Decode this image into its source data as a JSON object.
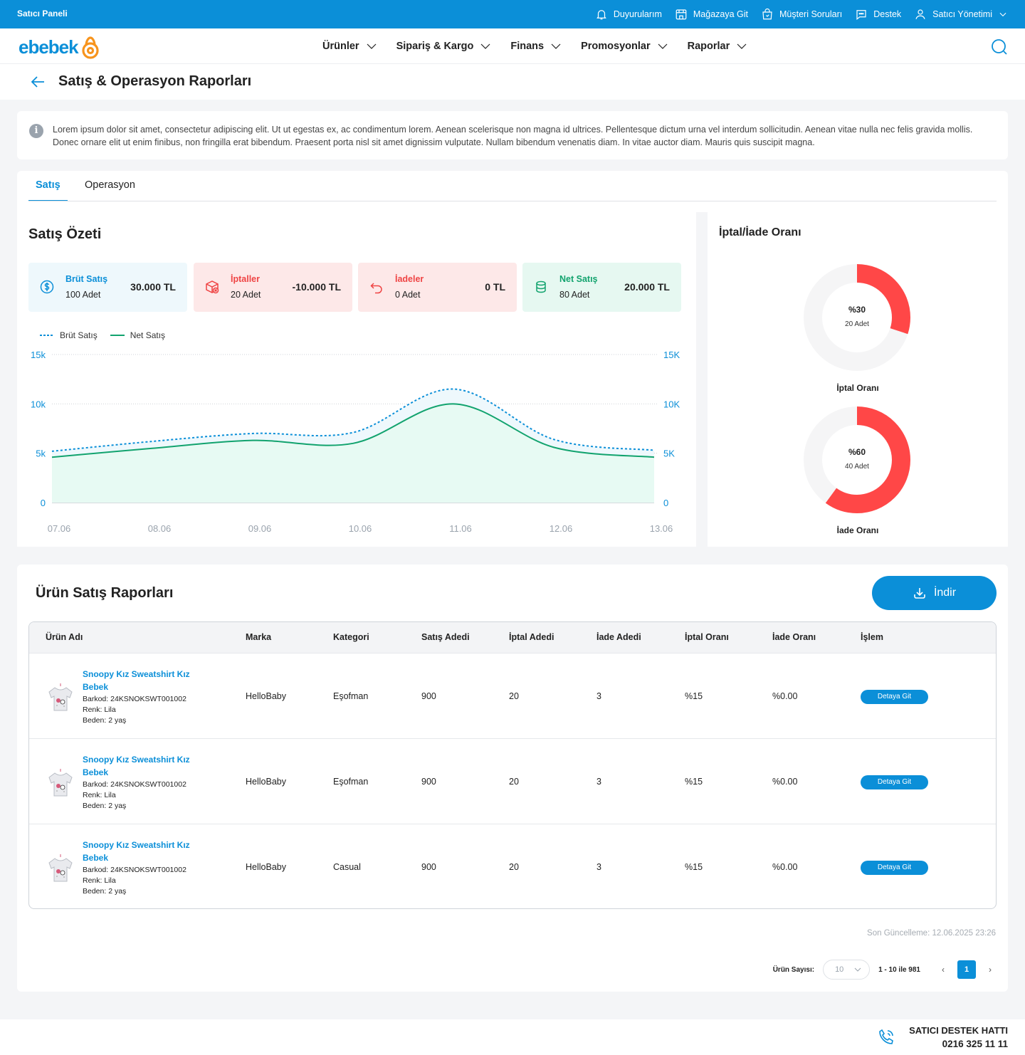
{
  "topbar": {
    "brand": "Satıcı Paneli",
    "links": [
      "Duyurularım",
      "Mağazaya Git",
      "Müşteri Soruları",
      "Destek",
      "Satıcı Yönetimi"
    ]
  },
  "nav": {
    "logo": "ebebek",
    "menu": [
      "Ürünler",
      "Sipariş & Kargo",
      "Finans",
      "Promosyonlar",
      "Raporlar"
    ]
  },
  "page": {
    "title": "Satış & Operasyon Raporları"
  },
  "info": {
    "text": "Lorem ipsum dolor sit amet, consectetur adipiscing elit. Ut ut egestas ex, ac condimentum lorem. Aenean scelerisque non magna id ultrices. Pellentesque dictum urna vel interdum sollicitudin. Aenean vitae nulla nec felis gravida mollis. Donec ornare elit ut enim finibus, non fringilla erat bibendum. Praesent porta nisl sit amet dignissim vulputate. Nullam bibendum venenatis diam. In vitae auctor diam. Mauris quis suscipit magna."
  },
  "tabs": [
    "Satış",
    "Operasyon"
  ],
  "summary": {
    "title": "Satış Özeti",
    "cards": [
      {
        "title": "Brüt Satış",
        "sub": "100 Adet",
        "value": "30.000 TL",
        "color": "#0b8fd8",
        "bg": "#eef8fc"
      },
      {
        "title": "İptaller",
        "sub": "20 Adet",
        "value": "-10.000 TL",
        "color": "#ef4444",
        "bg": "#fde8e8"
      },
      {
        "title": "İadeler",
        "sub": "0 Adet",
        "value": "0 TL",
        "color": "#ef4444",
        "bg": "#fde8e8"
      },
      {
        "title": "Net Satış",
        "sub": "80 Adet",
        "value": "20.000 TL",
        "color": "#12a36e",
        "bg": "#e6f8f1"
      }
    ],
    "legend": [
      "Brüt Satış",
      "Net Satış"
    ]
  },
  "chart_data": {
    "type": "area",
    "x": [
      "07.06",
      "08.06",
      "09.06",
      "10.06",
      "11.06",
      "12.06",
      "13.06"
    ],
    "series": [
      {
        "name": "Brüt Satış",
        "values": [
          5200,
          6200,
          7000,
          7100,
          11500,
          6400,
          5300
        ],
        "style": "dotted",
        "color": "#0b8fd8"
      },
      {
        "name": "Net Satış",
        "values": [
          4600,
          5500,
          6300,
          6000,
          10000,
          5600,
          4600
        ],
        "style": "solid",
        "color": "#12a36e"
      }
    ],
    "y_left_ticks": [
      "0",
      "5k",
      "10k",
      "15k"
    ],
    "y_right_ticks": [
      "0",
      "5K",
      "10K",
      "15K"
    ],
    "ylim": [
      0,
      15000
    ],
    "grid": true,
    "legend_position": "top-left"
  },
  "ratio": {
    "title": "İptal/İade Oranı",
    "items": [
      {
        "pct": "%30",
        "count": "20 Adet",
        "label": "İptal Oranı",
        "value": 0.3
      },
      {
        "pct": "%60",
        "count": "40 Adet",
        "label": "İade Oranı",
        "value": 0.6
      }
    ],
    "accent": "#ff4747"
  },
  "report": {
    "title": "Ürün Satış Raporları",
    "download": "İndir",
    "columns": [
      "Ürün Adı",
      "Marka",
      "Kategori",
      "Satış Adedi",
      "İptal Adedi",
      "İade Adedi",
      "İptal Oranı",
      "İade Oranı",
      "İşlem"
    ],
    "rows": [
      {
        "name": "Snoopy Kız Sweatshirt Kız Bebek",
        "barcode": "Barkod: 24KSNOKSWT001002",
        "color": "Renk: Lila",
        "size": "Beden: 2 yaş",
        "brand": "HelloBaby",
        "category": "Eşofman",
        "sold": "900",
        "cancel": "20",
        "returns": "3",
        "cancel_rate": "%15",
        "return_rate": "%0.00",
        "action": "Detaya Git"
      },
      {
        "name": "Snoopy Kız Sweatshirt Kız Bebek",
        "barcode": "Barkod: 24KSNOKSWT001002",
        "color": "Renk: Lila",
        "size": "Beden: 2 yaş",
        "brand": "HelloBaby",
        "category": "Eşofman",
        "sold": "900",
        "cancel": "20",
        "returns": "3",
        "cancel_rate": "%15",
        "return_rate": "%0.00",
        "action": "Detaya Git"
      },
      {
        "name": "Snoopy Kız Sweatshirt Kız Bebek",
        "barcode": "Barkod: 24KSNOKSWT001002",
        "color": "Renk: Lila",
        "size": "Beden: 2 yaş",
        "brand": "HelloBaby",
        "category": "Casual",
        "sold": "900",
        "cancel": "20",
        "returns": "3",
        "cancel_rate": "%15",
        "return_rate": "%0.00",
        "action": "Detaya Git"
      }
    ],
    "updated": "Son Güncelleme: 12.06.2025 23:26",
    "pager": {
      "label": "Ürün Sayısı:",
      "per_page": "10",
      "range": "1 - 10 ile 981",
      "page": "1",
      "prev": "‹",
      "next": "›"
    }
  },
  "footer": {
    "line1": "SATICI DESTEK HATTI",
    "line2": "0216 325 11 11"
  }
}
